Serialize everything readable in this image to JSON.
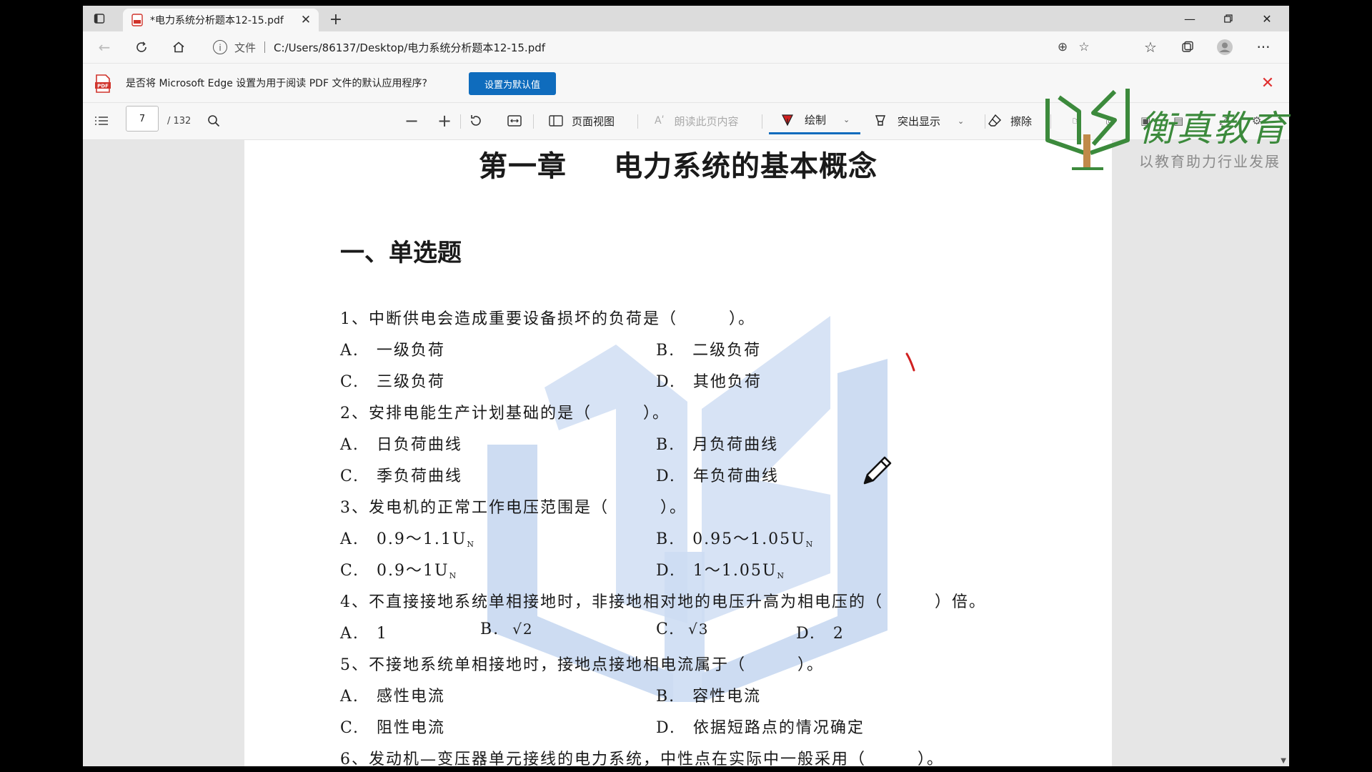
{
  "browser": {
    "tab_title": "*电力系统分析题本12-15.pdf",
    "address_prefix": "文件",
    "url": "C:/Users/86137/Desktop/电力系统分析题本12-15.pdf"
  },
  "infobar": {
    "message": "是否将 Microsoft Edge 设置为用于阅读 PDF 文件的默认应用程序?",
    "set_default_button": "设置为默认值"
  },
  "pdf_toolbar": {
    "current_page": "7",
    "page_total": "/ 132",
    "page_view_label": "页面视图",
    "read_aloud_label": "朗读此页内容",
    "draw_label": "绘制",
    "highlight_label": "突出显示",
    "erase_label": "擦除"
  },
  "document": {
    "chapter_number": "第一章",
    "chapter_title": "电力系统的基本概念",
    "section_title": "一、单选题",
    "q1": "1、中断供电会造成重要设备损坏的负荷是（　　　）。",
    "q1_a": "A.　一级负荷",
    "q1_b": "B.　二级负荷",
    "q1_c": "C.　三级负荷",
    "q1_d": "D.　其他负荷",
    "q2": "2、安排电能生产计划基础的是（　　　）。",
    "q2_a": "A.　日负荷曲线",
    "q2_b": "B.　月负荷曲线",
    "q2_c": "C.　季负荷曲线",
    "q2_d": "D.　年负荷曲线",
    "q3": "3、发电机的正常工作电压范围是（　　　）。",
    "q3_a": "A.　0.9～1.1U",
    "q3_b": "B.　0.95～1.05U",
    "q3_c": "C.　0.9～1U",
    "q3_d": "D.　1～1.05U",
    "subscript_n": "N",
    "q4": "4、不直接接地系统单相接地时，非接地相对地的电压升高为相电压的（　　　）倍。",
    "q4_a": "A.　1",
    "q4_b": "B.",
    "q4_b_val": "√2",
    "q4_c": "C.",
    "q4_c_val": "√3",
    "q4_d": "D.　2",
    "q5": "5、不接地系统单相接地时，接地点接地相电流属于（　　　）。",
    "q5_a": "A.　感性电流",
    "q5_b": "B.　容性电流",
    "q5_c": "C.　阻性电流",
    "q5_d": "D.　依据短路点的情况确定",
    "q6": "6、发动机—变压器单元接线的电力系统，中性点在实际中一般采用（　　　）。"
  },
  "logo": {
    "name": "衡真教育",
    "slogan": "以教育助力行业发展"
  },
  "colors": {
    "accent": "#0f6cbd",
    "watermark": "#5b8fd6",
    "logo_green": "#3c8a3c",
    "pen_mark": "#d02020"
  }
}
